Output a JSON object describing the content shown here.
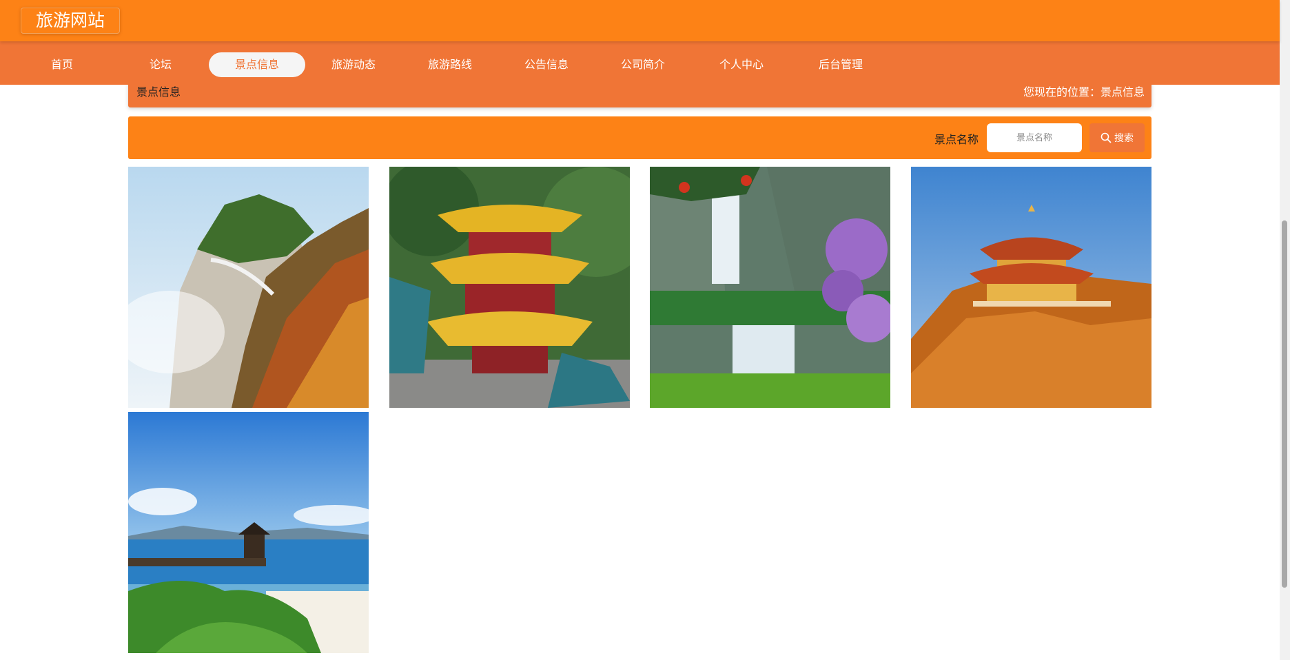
{
  "header": {
    "site_title": "旅游网站"
  },
  "nav": {
    "items": [
      {
        "label": "首页"
      },
      {
        "label": "论坛"
      },
      {
        "label": "景点信息",
        "active": true
      },
      {
        "label": "旅游动态"
      },
      {
        "label": "旅游路线"
      },
      {
        "label": "公告信息"
      },
      {
        "label": "公司简介"
      },
      {
        "label": "个人中心"
      },
      {
        "label": "后台管理"
      }
    ]
  },
  "breadcrumb": {
    "title": "景点信息",
    "position": "您现在的位置：景点信息"
  },
  "search": {
    "label": "景点名称",
    "placeholder": "景点名称",
    "value": "",
    "button_label": "搜索",
    "button_icon": "search-icon"
  },
  "attractions": [
    {
      "image": "mountain-cliff-plank-road-photo"
    },
    {
      "image": "yellow-crane-tower-photo"
    },
    {
      "image": "waterfall-valley-photo"
    },
    {
      "image": "golden-summit-temple-photo"
    },
    {
      "image": "seaside-pier-pavilion-photo"
    }
  ],
  "colors": {
    "header_orange": "#fd8216",
    "nav_orange": "#f07536",
    "active_tab_bg": "#f5f5f5"
  }
}
